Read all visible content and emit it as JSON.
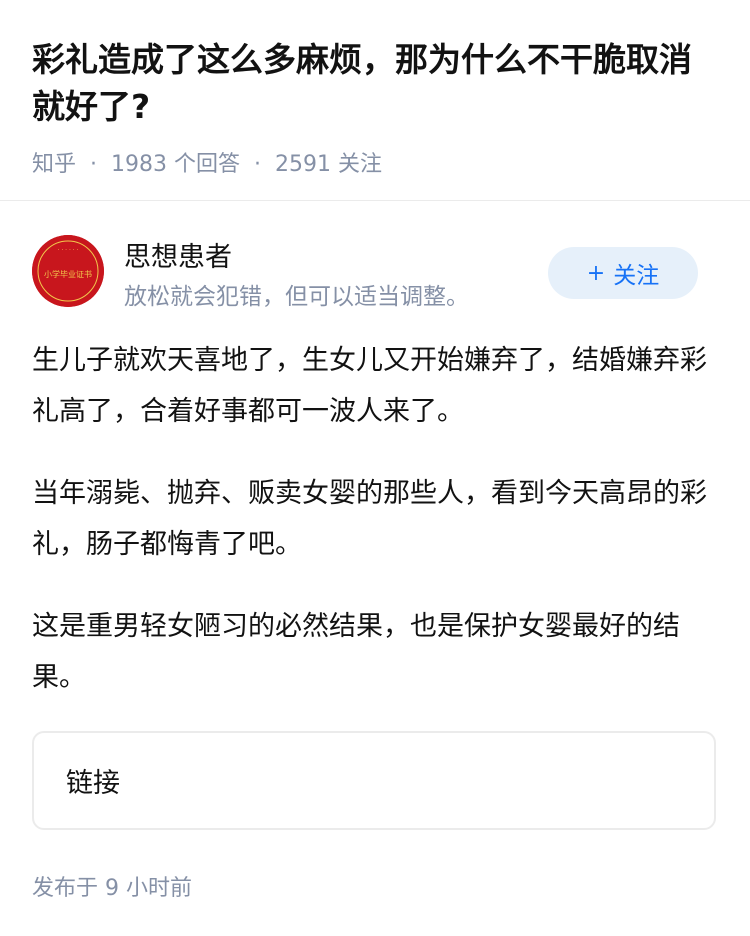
{
  "question": {
    "title": "彩礼造成了这么多麻烦，那为什么不干脆取消就好了?",
    "source": "知乎",
    "answer_count": "1983 个回答",
    "follow_count": "2591 关注"
  },
  "author": {
    "name": "思想患者",
    "bio": "放松就会犯错，但可以适当调整。",
    "avatar_text": "小学毕业证书",
    "follow_label": "关注",
    "follow_plus": "+"
  },
  "answer": {
    "paragraphs": [
      "生儿子就欢天喜地了，生女儿又开始嫌弃了，结婚嫌弃彩礼高了，合着好事都可一波人来了。",
      "当年溺毙、抛弃、贩卖女婴的那些人，看到今天高昂的彩礼，肠子都悔青了吧。",
      "这是重男轻女陋习的必然结果，也是保护女婴最好的结果。"
    ]
  },
  "link_card": {
    "label": "链接"
  },
  "publish_time": "发布于 9 小时前",
  "colors": {
    "accent": "#1772f6",
    "meta": "#8590a6",
    "avatar": "#c8161d"
  }
}
